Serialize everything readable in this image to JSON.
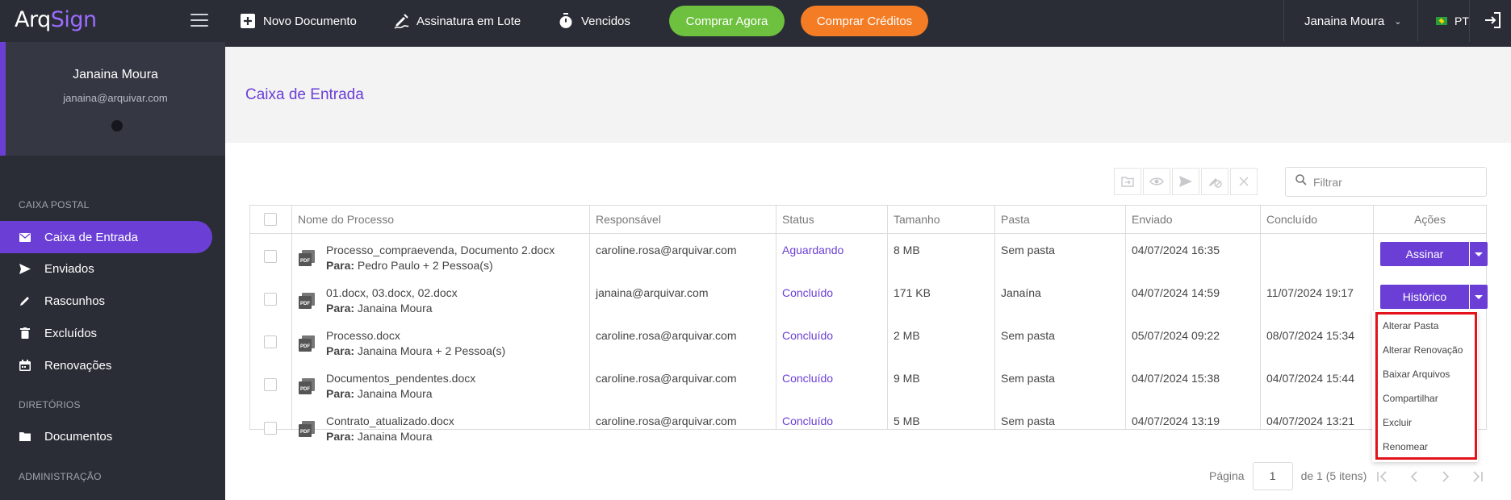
{
  "app": {
    "logo_a": "Arq",
    "logo_b": "Sign"
  },
  "profile": {
    "name": "Janaina Moura",
    "email": "janaina@arquivar.com"
  },
  "sidebar": {
    "sections": [
      {
        "title": "CAIXA POSTAL"
      },
      {
        "title": "DIRETÓRIOS"
      },
      {
        "title": "ADMINISTRAÇÃO"
      }
    ],
    "items": [
      {
        "label": "Caixa de Entrada",
        "icon": "mail-icon"
      },
      {
        "label": "Enviados",
        "icon": "send-icon"
      },
      {
        "label": "Rascunhos",
        "icon": "pencil-icon"
      },
      {
        "label": "Excluídos",
        "icon": "trash-icon"
      },
      {
        "label": "Renovações",
        "icon": "calendar-icon"
      },
      {
        "label": "Documentos",
        "icon": "folder-icon"
      }
    ]
  },
  "topbar": {
    "new_document": "Novo Documento",
    "batch_signature": "Assinatura em Lote",
    "expired": "Vencidos",
    "buy_now": "Comprar Agora",
    "buy_credits": "Comprar Créditos",
    "user": "Janaina Moura",
    "lang": "PT",
    "colors": {
      "buy_now": "#6ec13f",
      "buy_credits": "#f47c24",
      "accent": "#6b3fd6"
    }
  },
  "page": {
    "title": "Caixa de Entrada",
    "filter_placeholder": "Filtrar"
  },
  "table": {
    "headers": [
      "Nome do Processo",
      "Responsável",
      "Status",
      "Tamanho",
      "Pasta",
      "Enviado",
      "Concluído",
      "Ações"
    ],
    "rows": [
      {
        "name": "Processo_compraevenda, Documento 2.docx",
        "to_label": "Para:",
        "to": "Pedro Paulo + 2 Pessoa(s)",
        "responsible": "caroline.rosa@arquivar.com",
        "status": "Aguardando",
        "size": "8 MB",
        "folder": "Sem pasta",
        "sent": "04/07/2024 16:35",
        "completed": "",
        "action": "Assinar"
      },
      {
        "name": "01.docx, 03.docx, 02.docx",
        "to_label": "Para:",
        "to": "Janaina Moura",
        "responsible": "janaina@arquivar.com",
        "status": "Concluído",
        "size": "171 KB",
        "folder": "Janaína",
        "sent": "04/07/2024 14:59",
        "completed": "11/07/2024 19:17",
        "action": "Histórico"
      },
      {
        "name": "Processo.docx",
        "to_label": "Para:",
        "to": "Janaina Moura + 2 Pessoa(s)",
        "responsible": "caroline.rosa@arquivar.com",
        "status": "Concluído",
        "size": "2 MB",
        "folder": "Sem pasta",
        "sent": "05/07/2024 09:22",
        "completed": "08/07/2024 15:34",
        "action": ""
      },
      {
        "name": "Documentos_pendentes.docx",
        "to_label": "Para:",
        "to": "Janaina Moura",
        "responsible": "caroline.rosa@arquivar.com",
        "status": "Concluído",
        "size": "9 MB",
        "folder": "Sem pasta",
        "sent": "04/07/2024 15:38",
        "completed": "04/07/2024 15:44",
        "action": ""
      },
      {
        "name": "Contrato_atualizado.docx",
        "to_label": "Para:",
        "to": "Janaina Moura",
        "responsible": "caroline.rosa@arquivar.com",
        "status": "Concluído",
        "size": "5 MB",
        "folder": "Sem pasta",
        "sent": "04/07/2024 13:19",
        "completed": "04/07/2024 13:21",
        "action": ""
      }
    ]
  },
  "dropdown": {
    "items": [
      "Alterar Pasta",
      "Alterar Renovação",
      "Baixar Arquivos",
      "Compartilhar",
      "Excluir",
      "Renomear"
    ]
  },
  "pager": {
    "label": "Página",
    "page": "1",
    "suffix": "de 1 (5 itens)"
  }
}
